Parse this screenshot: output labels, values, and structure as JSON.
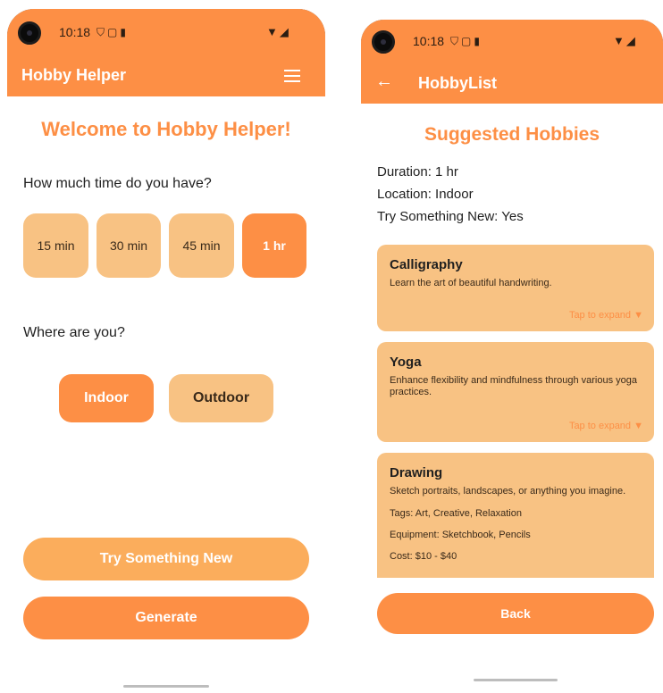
{
  "status": {
    "time": "10:18",
    "left_icons": [
      "shield-icon",
      "sim-icon",
      "card-icon"
    ],
    "right_icons": [
      "wifi-icon",
      "signal-icon"
    ]
  },
  "screen_left": {
    "app_title": "Hobby Helper",
    "welcome": "Welcome to Hobby Helper!",
    "time_question": "How much time do you have?",
    "time_options": [
      "15 min",
      "30 min",
      "45 min",
      "1 hr"
    ],
    "time_selected": "1 hr",
    "location_question": "Where are you?",
    "location_options": [
      "Indoor",
      "Outdoor"
    ],
    "location_selected": "Indoor",
    "try_new_label": "Try Something New",
    "generate_label": "Generate"
  },
  "screen_right": {
    "app_title": "HobbyList",
    "title": "Suggested Hobbies",
    "duration_line": "Duration: 1 hr",
    "location_line": "Location: Indoor",
    "try_line": "Try Something New: Yes",
    "cards": [
      {
        "title": "Calligraphy",
        "desc": "Learn the art of beautiful handwriting.",
        "expand": "Tap to expand ▼"
      },
      {
        "title": "Yoga",
        "desc": "Enhance flexibility and mindfulness through various yoga practices.",
        "expand": "Tap to expand ▼"
      },
      {
        "title": "Drawing",
        "desc": "Sketch portraits, landscapes, or anything you imagine.",
        "tags": "Tags: Art, Creative, Relaxation",
        "equipment": "Equipment: Sketchbook, Pencils",
        "cost": "Cost: $10 - $40"
      }
    ],
    "back_label": "Back"
  },
  "colors": {
    "primary": "#fd8f45",
    "light": "#f8c283",
    "try_button": "#fbad5c"
  }
}
